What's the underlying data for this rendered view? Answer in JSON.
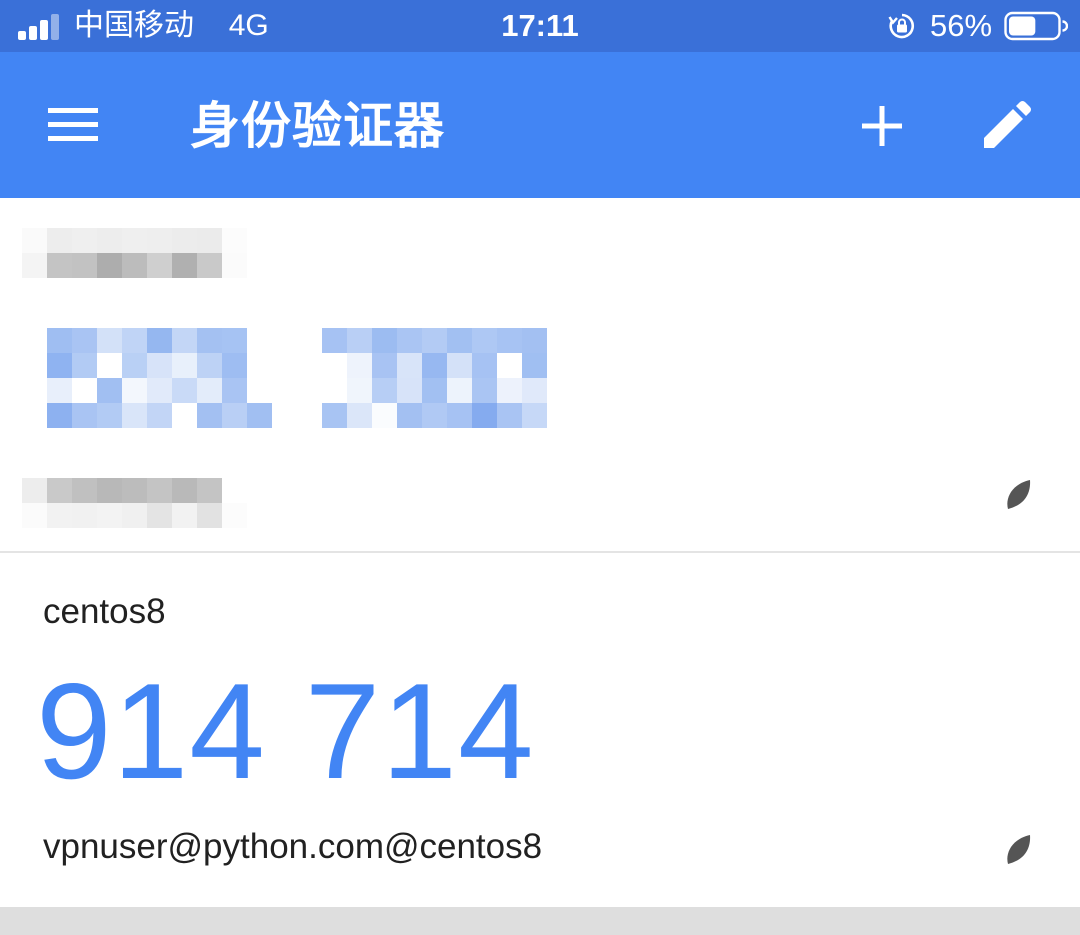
{
  "status_bar": {
    "carrier": "中国移动",
    "network": "4G",
    "time": "17:11",
    "battery_percent": "56%",
    "battery_level": 0.56,
    "signal_icon": "signal-bars-icon",
    "lock_icon": "orientation-lock-icon",
    "battery_icon": "battery-icon"
  },
  "app_bar": {
    "title": "身份验证器",
    "menu_icon": "hamburger-menu-icon",
    "add_icon": "plus-icon",
    "edit_icon": "pencil-icon"
  },
  "accounts": [
    {
      "issuer": "",
      "code": "",
      "account": "",
      "redacted": true,
      "countdown_icon": "countdown-timer-icon"
    },
    {
      "issuer": "centos8",
      "code": "914 714",
      "account": "vpnuser@python.com@centos8",
      "redacted": false,
      "countdown_icon": "countdown-timer-icon"
    }
  ],
  "colors": {
    "status_bar": "#3a70d8",
    "app_bar": "#4285f4",
    "code": "#4285f4",
    "text": "#212121",
    "countdown": "#555555"
  }
}
